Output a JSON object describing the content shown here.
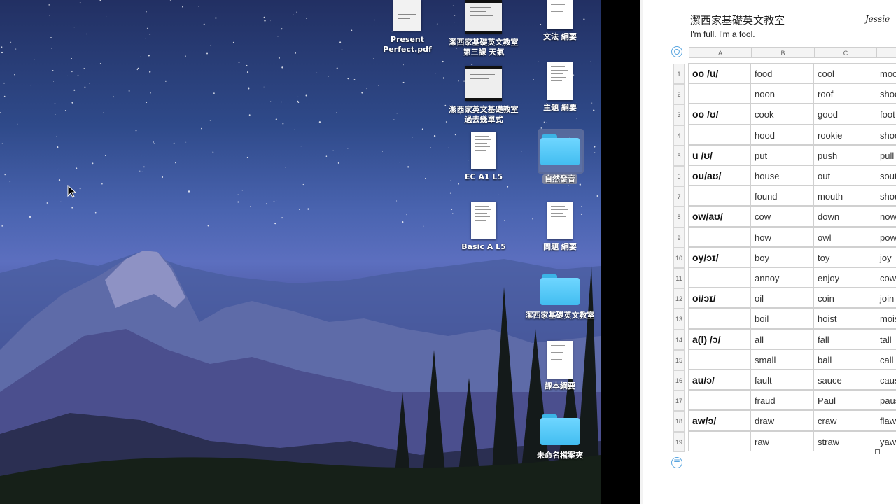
{
  "desktop": {
    "icons": [
      {
        "label": "Present\nPerfect.pdf",
        "kind": "thumb"
      },
      {
        "label": "潔西家基礎英文教室\n第三課 天氣",
        "kind": "thumb"
      },
      {
        "label": "文法 綱要",
        "kind": "doc"
      },
      {
        "label": "潔西家英文基礎教室\n過去幾單式",
        "kind": "thumb"
      },
      {
        "label": "主題 綱要",
        "kind": "doc"
      },
      {
        "label": "EC A1 L5",
        "kind": "doc"
      },
      {
        "label": "自然發音",
        "kind": "folder",
        "selected": true
      },
      {
        "label": "Basic A L5",
        "kind": "doc"
      },
      {
        "label": "問題 綱要",
        "kind": "doc"
      },
      {
        "label": "潔西家基礎英文教室",
        "kind": "folder"
      },
      {
        "label": "課本綱要",
        "kind": "doc"
      },
      {
        "label": "未命名檔案夾",
        "kind": "folder"
      }
    ]
  },
  "sheet": {
    "title": "潔西家基礎英文教室",
    "author": "Jessie",
    "subtitle": "I'm full.   I'm a fool.",
    "columns": [
      "A",
      "B",
      "C"
    ],
    "rows": [
      {
        "num": "1",
        "a": "oo /u/",
        "b": "food",
        "c": "cool",
        "d": "mood"
      },
      {
        "num": "2",
        "a": "",
        "b": "noon",
        "c": "roof",
        "d": "shoot"
      },
      {
        "num": "3",
        "a": "oo /ʊ/",
        "b": "cook",
        "c": "good",
        "d": "foot"
      },
      {
        "num": "4",
        "a": "",
        "b": "hood",
        "c": "rookie",
        "d": "shook"
      },
      {
        "num": "5",
        "a": "u /ʊ/",
        "b": "put",
        "c": "push",
        "d": "pull"
      },
      {
        "num": "6",
        "a": "ou/aʊ/",
        "b": "house",
        "c": "out",
        "d": "south"
      },
      {
        "num": "7",
        "a": "",
        "b": "found",
        "c": "mouth",
        "d": "shout"
      },
      {
        "num": "8",
        "a": "ow/aʊ/",
        "b": "cow",
        "c": "down",
        "d": "now"
      },
      {
        "num": "9",
        "a": "",
        "b": "how",
        "c": "owl",
        "d": "power"
      },
      {
        "num": "10",
        "a": "oy/ɔɪ/",
        "b": "boy",
        "c": "toy",
        "d": "joy"
      },
      {
        "num": "11",
        "a": "",
        "b": "annoy",
        "c": "enjoy",
        "d": "cowboy"
      },
      {
        "num": "12",
        "a": "oi/ɔɪ/",
        "b": "oil",
        "c": "coin",
        "d": "join"
      },
      {
        "num": "13",
        "a": "",
        "b": "boil",
        "c": "hoist",
        "d": "moist"
      },
      {
        "num": "14",
        "a": "a(l) /ɔ/",
        "b": "all",
        "c": "fall",
        "d": "tall"
      },
      {
        "num": "15",
        "a": "",
        "b": "small",
        "c": "ball",
        "d": "call"
      },
      {
        "num": "16",
        "a": "au/ɔ/",
        "b": "fault",
        "c": "sauce",
        "d": "cause"
      },
      {
        "num": "17",
        "a": "",
        "b": "fraud",
        "c": "Paul",
        "d": "pause"
      },
      {
        "num": "18",
        "a": "aw/ɔ/",
        "b": "draw",
        "c": "craw",
        "d": "flaw"
      },
      {
        "num": "19",
        "a": "",
        "b": "raw",
        "c": "straw",
        "d": "yawn"
      }
    ]
  }
}
